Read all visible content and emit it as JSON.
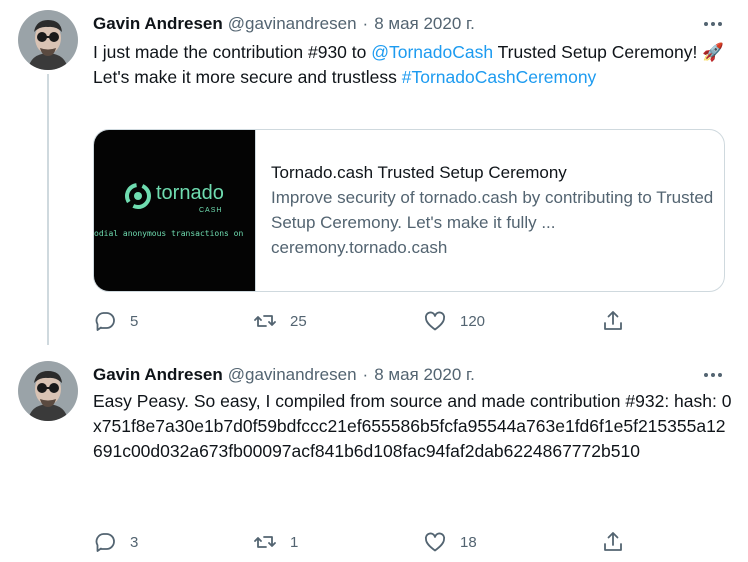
{
  "tweets": [
    {
      "author": {
        "name": "Gavin Andresen",
        "handle": "@gavinandresen"
      },
      "separator": "·",
      "date": "8 мая 2020 г.",
      "text_parts": {
        "before_mention": "I just made the contribution #930 to ",
        "mention": "@TornadoCash",
        "after_mention": " Trusted Setup Ceremony! 🚀 Let's make it more secure and trustless ",
        "hashtag": "#TornadoCashCeremony"
      },
      "card": {
        "thumb_logo_text": "tornado",
        "thumb_sub_text": "CASH",
        "thumb_ticker": "odial anonymous transactions on",
        "title": "Tornado.cash Trusted Setup Ceremony",
        "description": "Improve security of tornado.cash by contributing to Trusted Setup Ceremony. Let's make it fully ...",
        "domain": "ceremony.tornado.cash"
      },
      "stats": {
        "replies": "5",
        "retweets": "25",
        "likes": "120"
      }
    },
    {
      "author": {
        "name": "Gavin Andresen",
        "handle": "@gavinandresen"
      },
      "separator": "·",
      "date": "8 мая 2020 г.",
      "text": "Easy Peasy. So easy, I compiled from source and made contribution #932: hash: 0x751f8e7a30e1b7d0f59bdfccc21ef655586b5fcfa95544a763e1fd6f1e5f215355a12691c00d032a673fb00097acf841b6d108fac94faf2dab6224867772b510",
      "stats": {
        "replies": "3",
        "retweets": "1",
        "likes": "18"
      }
    }
  ],
  "icons": {
    "more": "more-horizontal-icon",
    "reply": "reply-bubble-icon",
    "retweet": "retweet-arrows-icon",
    "like": "heart-outline-icon",
    "share": "share-upload-icon"
  },
  "colors": {
    "text": "#0f1419",
    "secondary": "#536471",
    "link": "#1d9bf0",
    "border": "#cfd9de",
    "tornado_green": "#6fdcb0"
  }
}
